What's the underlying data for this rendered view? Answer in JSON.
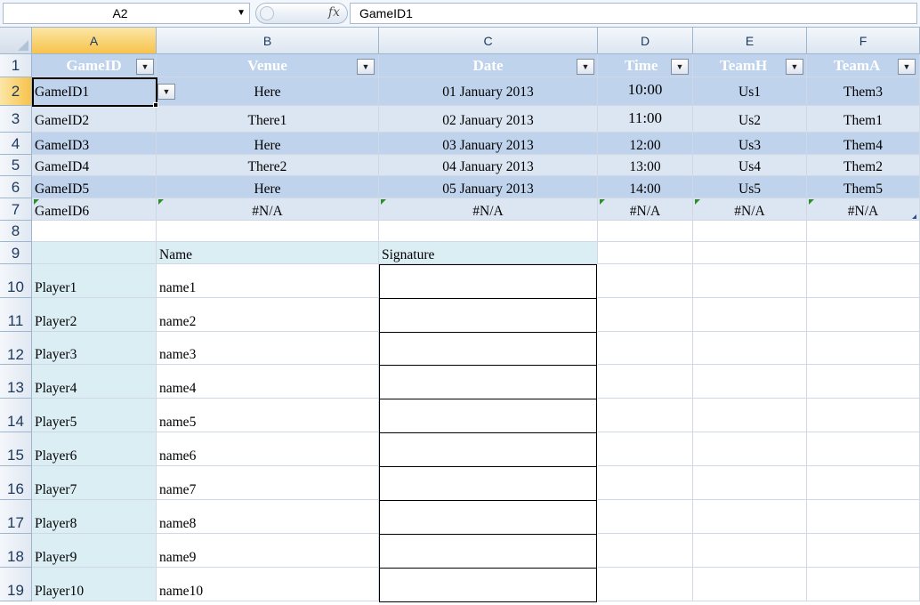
{
  "formula_bar": {
    "name_box": "A2",
    "fx_label": "fx",
    "formula": "GameID1"
  },
  "columns": [
    "A",
    "B",
    "C",
    "D",
    "E",
    "F"
  ],
  "rows": [
    "1",
    "2",
    "3",
    "4",
    "5",
    "6",
    "7",
    "8",
    "9",
    "10",
    "11",
    "12",
    "13",
    "14",
    "15",
    "16",
    "17",
    "18",
    "19"
  ],
  "table": {
    "headers": [
      "GameID",
      "Venue",
      "Date",
      "Time",
      "TeamH",
      "TeamA"
    ],
    "rows": [
      [
        "GameID1",
        "Here",
        "01 January 2013",
        "10:00",
        "Us1",
        "Them3"
      ],
      [
        "GameID2",
        "There1",
        "02 January 2013",
        "11:00",
        "Us2",
        "Them1"
      ],
      [
        "GameID3",
        "Here",
        "03 January 2013",
        "12:00",
        "Us3",
        "Them4"
      ],
      [
        "GameID4",
        "There2",
        "04 January 2013",
        "13:00",
        "Us4",
        "Them2"
      ],
      [
        "GameID5",
        "Here",
        "05 January 2013",
        "14:00",
        "Us5",
        "Them5"
      ],
      [
        "GameID6",
        "#N/A",
        "#N/A",
        "#N/A",
        "#N/A",
        "#N/A"
      ]
    ]
  },
  "signup": {
    "name_header": "Name",
    "signature_header": "Signature",
    "players": [
      {
        "player": "Player1",
        "name": "name1"
      },
      {
        "player": "Player2",
        "name": "name2"
      },
      {
        "player": "Player3",
        "name": "name3"
      },
      {
        "player": "Player4",
        "name": "name4"
      },
      {
        "player": "Player5",
        "name": "name5"
      },
      {
        "player": "Player6",
        "name": "name6"
      },
      {
        "player": "Player7",
        "name": "name7"
      },
      {
        "player": "Player8",
        "name": "name8"
      },
      {
        "player": "Player9",
        "name": "name9"
      },
      {
        "player": "Player10",
        "name": "name10"
      }
    ]
  },
  "colors": {
    "table_header": "#bfd3ec",
    "band_dark": "#bfd3ec",
    "band_light": "#dce6f2",
    "selection_header": "#f7c34b",
    "player_column": "#dbeef4"
  }
}
